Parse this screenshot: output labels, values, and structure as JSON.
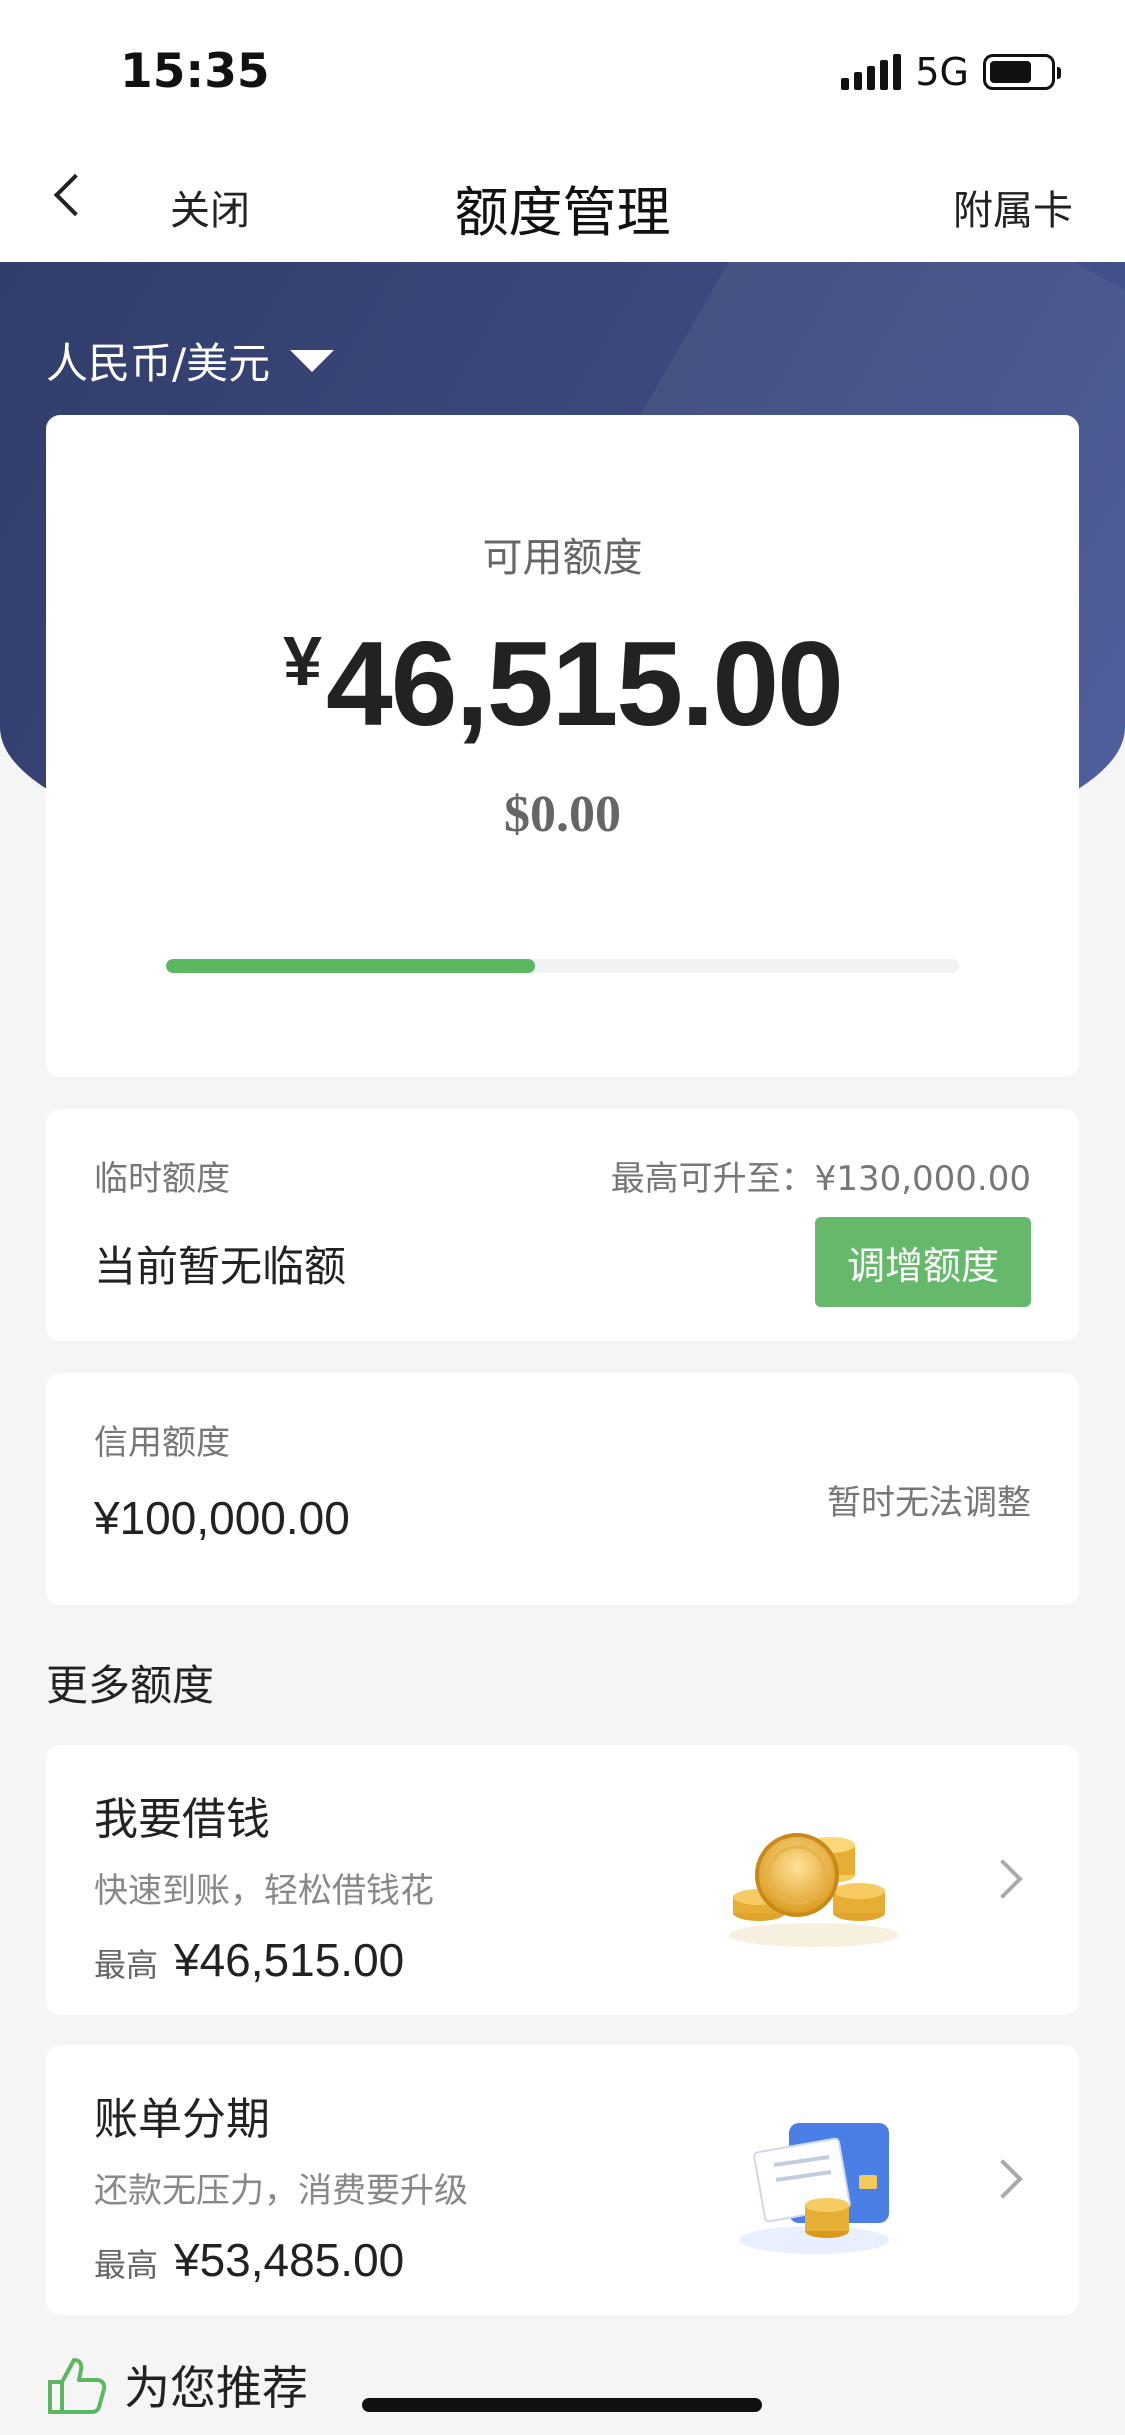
{
  "status": {
    "time": "15:35",
    "network": "5G"
  },
  "nav": {
    "close_label": "关闭",
    "title": "额度管理",
    "right_label": "附属卡"
  },
  "currency_selector": {
    "label": "人民币/美元"
  },
  "available": {
    "label": "可用额度",
    "currency_symbol": "¥",
    "amount": "46,515.00",
    "usd": "$0.00",
    "progress_fraction": 0.465
  },
  "temporary": {
    "label": "临时额度",
    "max_label": "最高可升至：¥130,000.00",
    "status": "当前暂无临额",
    "button": "调增额度"
  },
  "credit": {
    "label": "信用额度",
    "amount": "¥100,000.00",
    "note": "暂时无法调整"
  },
  "more": {
    "title": "更多额度"
  },
  "products": [
    {
      "title": "我要借钱",
      "desc": "快速到账，轻松借钱花",
      "max_label": "最高",
      "max_value": "¥46,515.00"
    },
    {
      "title": "账单分期",
      "desc": "还款无压力，消费要升级",
      "max_label": "最高",
      "max_value": "¥53,485.00"
    }
  ],
  "recommend": {
    "label": "为您推荐"
  },
  "colors": {
    "accent_green": "#5cb860",
    "banner": "#3d4a7e"
  },
  "icons": [
    "back-chevron-icon",
    "caret-down-icon",
    "chevron-right-icon",
    "thumbs-up-icon",
    "coins-icon",
    "bill-card-icon"
  ]
}
